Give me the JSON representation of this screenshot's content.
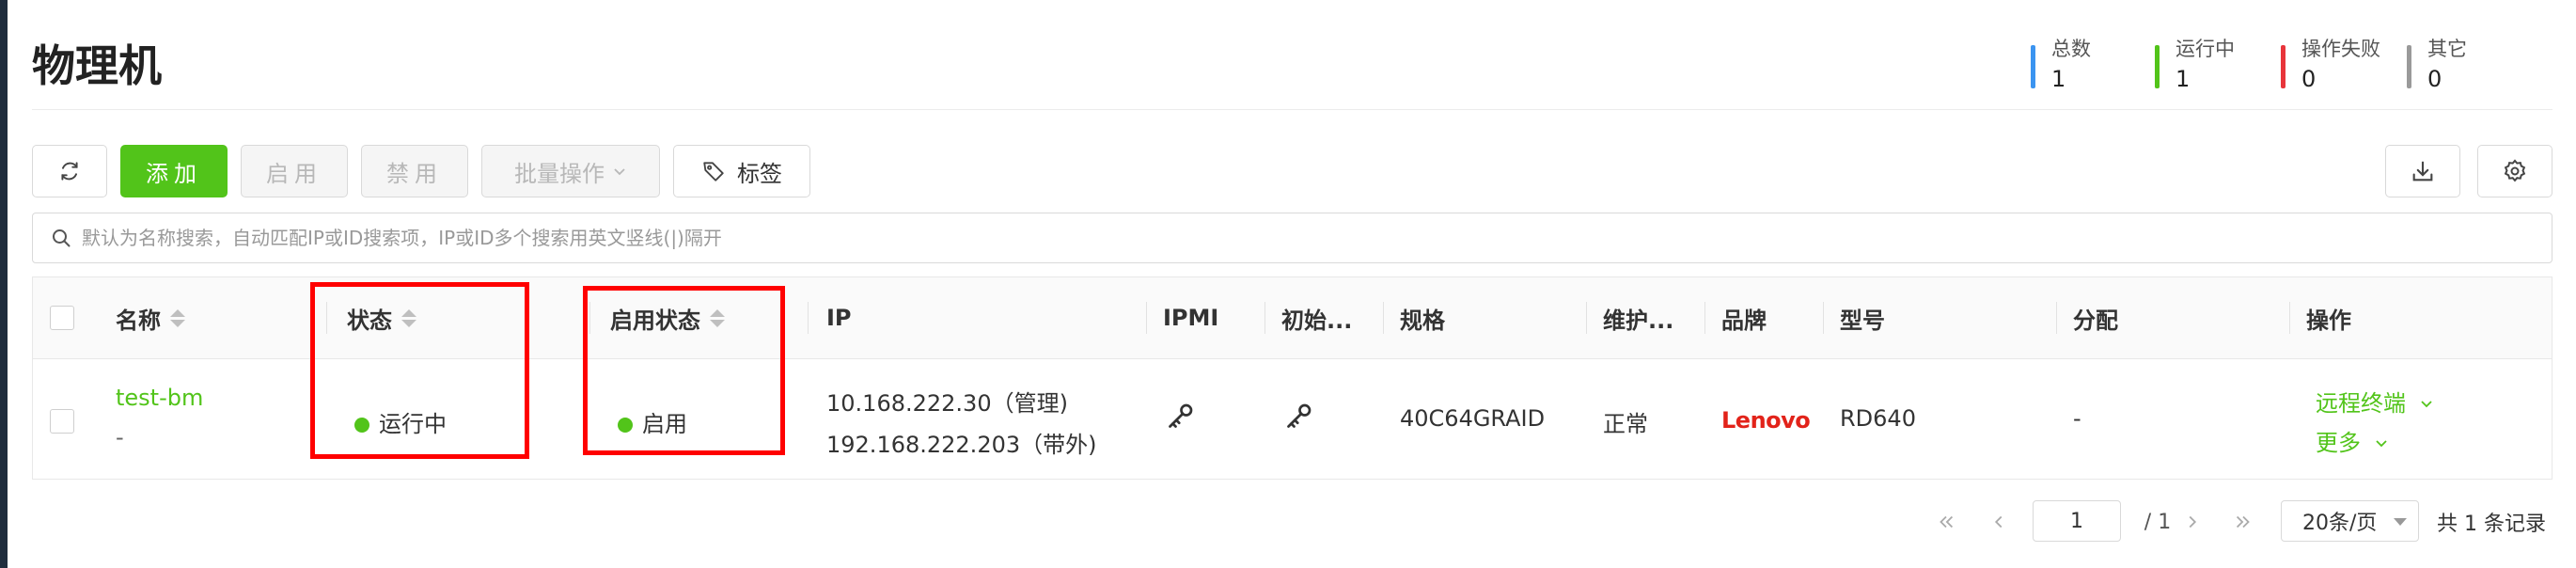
{
  "page": {
    "title": "物理机"
  },
  "stats": [
    {
      "label": "总数",
      "value": "1",
      "color": "#3b94f0"
    },
    {
      "label": "运行中",
      "value": "1",
      "color": "#52c41a"
    },
    {
      "label": "操作失败",
      "value": "0",
      "color": "#e8353b"
    },
    {
      "label": "其它",
      "value": "0",
      "color": "#9a9a9a"
    }
  ],
  "toolbar": {
    "refresh_icon": "refresh-icon",
    "add_label": "添加",
    "enable_label": "启用",
    "disable_label": "禁用",
    "batch_label": "批量操作",
    "tag_label": "标签",
    "download_icon": "download-icon",
    "settings_icon": "gear-icon"
  },
  "search": {
    "placeholder": "默认为名称搜索，自动匹配IP或ID搜索项，IP或ID多个搜索用英文竖线(|)隔开",
    "value": ""
  },
  "table": {
    "columns": [
      "名称",
      "状态",
      "启用状态",
      "IP",
      "IPMI",
      "初始...",
      "规格",
      "维护...",
      "品牌",
      "型号",
      "分配",
      "操作"
    ],
    "rows": [
      {
        "name": "test-bm",
        "sub": "-",
        "status": "运行中",
        "enabled": "启用",
        "ip_line1": "10.168.222.30（管理)",
        "ip_line2": "192.168.222.203（带外)",
        "ipmi_icon": "key-icon",
        "init_icon": "key-icon",
        "spec": "40C64GRAID",
        "maintenance": "正常",
        "brand": "Lenovo",
        "model": "RD640",
        "assigned": "-",
        "action_terminal": "远程终端",
        "action_more": "更多"
      }
    ]
  },
  "pagination": {
    "current_page": "1",
    "total_pages": "/ 1",
    "page_size": "20条/页",
    "total": "共 1 条记录"
  }
}
